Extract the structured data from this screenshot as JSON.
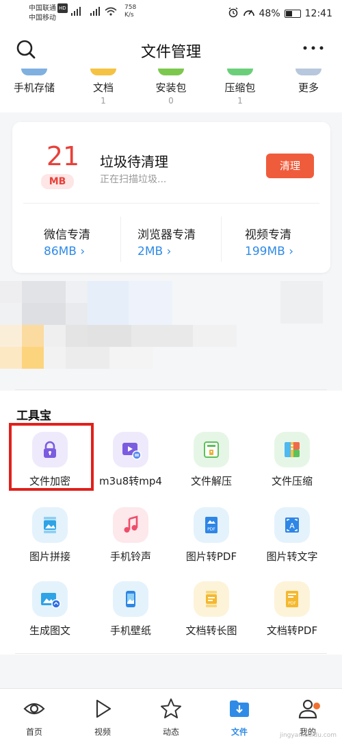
{
  "status_bar": {
    "carrier1": "中国联通",
    "carrier1_badge": "HD",
    "carrier2": "中国移动",
    "net_speed": "758",
    "net_speed_unit": "K/s",
    "battery": "48%",
    "time": "12:41"
  },
  "header": {
    "title": "文件管理"
  },
  "categories": [
    {
      "label": "手机存储",
      "count": "",
      "icon": "storage-icon",
      "color": "#7fb0e0"
    },
    {
      "label": "文档",
      "count": "1",
      "icon": "document-icon",
      "color": "#f5c242"
    },
    {
      "label": "安装包",
      "count": "0",
      "icon": "package-icon",
      "color": "#7cc84d"
    },
    {
      "label": "压缩包",
      "count": "1",
      "icon": "archive-icon",
      "color": "#6bcf7a"
    },
    {
      "label": "更多",
      "count": "",
      "icon": "more-icon",
      "color": "#b7c7dd"
    }
  ],
  "cleanup": {
    "junk_value": "21",
    "junk_unit": "MB",
    "title": "垃圾待清理",
    "subtitle": "正在扫描垃圾...",
    "clean_button": "清理",
    "items": [
      {
        "label": "微信专清",
        "value": "86MB"
      },
      {
        "label": "浏览器专清",
        "value": "2MB"
      },
      {
        "label": "视频专清",
        "value": "199MB"
      }
    ]
  },
  "toolbox": {
    "title": "工具宝",
    "tools": [
      {
        "label": "文件加密",
        "icon": "lock-icon"
      },
      {
        "label": "m3u8转mp4",
        "icon": "video-convert-icon"
      },
      {
        "label": "文件解压",
        "icon": "unzip-icon"
      },
      {
        "label": "文件压缩",
        "icon": "compress-icon"
      },
      {
        "label": "图片拼接",
        "icon": "image-stitch-icon"
      },
      {
        "label": "手机铃声",
        "icon": "ringtone-icon"
      },
      {
        "label": "图片转PDF",
        "icon": "image-to-pdf-icon"
      },
      {
        "label": "图片转文字",
        "icon": "image-to-text-icon"
      },
      {
        "label": "生成图文",
        "icon": "generate-image-text-icon"
      },
      {
        "label": "手机壁纸",
        "icon": "wallpaper-icon"
      },
      {
        "label": "文档转长图",
        "icon": "doc-to-long-image-icon"
      },
      {
        "label": "文档转PDF",
        "icon": "doc-to-pdf-icon"
      }
    ]
  },
  "bottom_nav": [
    {
      "label": "首页",
      "icon": "eye-icon",
      "active": false
    },
    {
      "label": "视频",
      "icon": "play-icon",
      "active": false
    },
    {
      "label": "动态",
      "icon": "star-icon",
      "active": false
    },
    {
      "label": "文件",
      "icon": "folder-download-icon",
      "active": true
    },
    {
      "label": "我的",
      "icon": "user-icon",
      "active": false
    }
  ],
  "watermark": "jingyan.baidu.com"
}
